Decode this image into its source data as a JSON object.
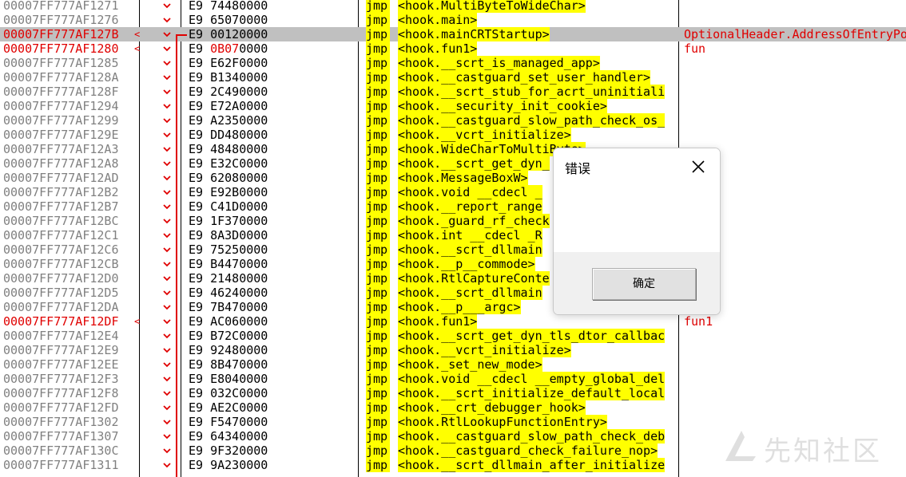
{
  "rows": [
    {
      "addr": "00007FF777AF1271",
      "bytes": "E9 74480000",
      "mnem": "jmp",
      "operand": "<hook.MultiByteToWideChar>"
    },
    {
      "addr": "00007FF777AF1276",
      "bytes": "E9 65070000",
      "mnem": "jmp",
      "operand": "<hook.main>"
    },
    {
      "addr": "00007FF777AF127B",
      "arrow": "<",
      "bytes": "E9 00120000",
      "mnem": "jmp",
      "operand": "<hook.mainCRTStartup>",
      "comment": "OptionalHeader.AddressOfEntryPoint",
      "selected": true
    },
    {
      "addr": "00007FF777AF1280",
      "arrow": "<",
      "bytes": "E9 0B070000",
      "bytes_pre": "E9 ",
      "bytes_hl": "0B07",
      "bytes_post": "0000",
      "mnem": "jmp",
      "operand": "<hook.fun1>",
      "comment": "fun"
    },
    {
      "addr": "00007FF777AF1285",
      "bytes": "E9 E62F0000",
      "mnem": "jmp",
      "operand": "<hook.__scrt_is_managed_app>"
    },
    {
      "addr": "00007FF777AF128A",
      "bytes": "E9 B1340000",
      "mnem": "jmp",
      "operand": "<hook.__castguard_set_user_handler>"
    },
    {
      "addr": "00007FF777AF128F",
      "bytes": "E9 2C490000",
      "mnem": "jmp",
      "operand": "<hook.__scrt_stub_for_acrt_uninitiali"
    },
    {
      "addr": "00007FF777AF1294",
      "bytes": "E9 E72A0000",
      "mnem": "jmp",
      "operand": "<hook.__security_init_cookie>"
    },
    {
      "addr": "00007FF777AF1299",
      "bytes": "E9 A2350000",
      "mnem": "jmp",
      "operand": "<hook.__castguard_slow_path_check_os_"
    },
    {
      "addr": "00007FF777AF129E",
      "bytes": "E9 DD480000",
      "mnem": "jmp",
      "operand": "<hook.__vcrt_initialize>"
    },
    {
      "addr": "00007FF777AF12A3",
      "bytes": "E9 48480000",
      "mnem": "jmp",
      "operand": "<hook.WideCharToMultiByte>"
    },
    {
      "addr": "00007FF777AF12A8",
      "bytes": "E9 E32C0000",
      "mnem": "jmp",
      "operand": "<hook.__scrt_get_dyn_"
    },
    {
      "addr": "00007FF777AF12AD",
      "bytes": "E9 62080000",
      "mnem": "jmp",
      "operand": "<hook.MessageBoxW>"
    },
    {
      "addr": "00007FF777AF12B2",
      "bytes": "E9 E92B0000",
      "mnem": "jmp",
      "operand": "<hook.void __cdecl _"
    },
    {
      "addr": "00007FF777AF12B7",
      "bytes": "E9 C41D0000",
      "mnem": "jmp",
      "operand": "<hook.__report_range"
    },
    {
      "addr": "00007FF777AF12BC",
      "bytes": "E9 1F370000",
      "mnem": "jmp",
      "operand": "<hook._guard_rf_check"
    },
    {
      "addr": "00007FF777AF12C1",
      "bytes": "E9 8A3D0000",
      "mnem": "jmp",
      "operand": "<hook.int __cdecl _R"
    },
    {
      "addr": "00007FF777AF12C6",
      "bytes": "E9 75250000",
      "mnem": "jmp",
      "operand": "<hook.__scrt_dllmain"
    },
    {
      "addr": "00007FF777AF12CB",
      "bytes": "E9 B4470000",
      "mnem": "jmp",
      "operand": "<hook.__p__commode>"
    },
    {
      "addr": "00007FF777AF12D0",
      "bytes": "E9 21480000",
      "mnem": "jmp",
      "operand": "<hook.RtlCaptureConte"
    },
    {
      "addr": "00007FF777AF12D5",
      "bytes": "E9 46240000",
      "mnem": "jmp",
      "operand": "<hook.__scrt_dllmain"
    },
    {
      "addr": "00007FF777AF12DA",
      "bytes": "E9 7B470000",
      "mnem": "jmp",
      "operand": "<hook.__p___argc>"
    },
    {
      "addr": "00007FF777AF12DF",
      "arrow": "<",
      "bytes": "E9 AC060000",
      "mnem": "jmp",
      "operand": "<hook.fun1>",
      "comment": "fun1"
    },
    {
      "addr": "00007FF777AF12E4",
      "bytes": "E9 B72C0000",
      "mnem": "jmp",
      "operand": "<hook.__scrt_get_dyn_tls_dtor_callbac"
    },
    {
      "addr": "00007FF777AF12E9",
      "bytes": "E9 92480000",
      "mnem": "jmp",
      "operand": "<hook.__vcrt_initialize>"
    },
    {
      "addr": "00007FF777AF12EE",
      "bytes": "E9 8B470000",
      "mnem": "jmp",
      "operand": "<hook._set_new_mode>"
    },
    {
      "addr": "00007FF777AF12F3",
      "bytes": "E9 E8040000",
      "mnem": "jmp",
      "operand": "<hook.void __cdecl __empty_global_del"
    },
    {
      "addr": "00007FF777AF12F8",
      "bytes": "E9 032C0000",
      "mnem": "jmp",
      "operand": "<hook.__scrt_initialize_default_local"
    },
    {
      "addr": "00007FF777AF12FD",
      "bytes": "E9 AE2C0000",
      "mnem": "jmp",
      "operand": "<hook.__crt_debugger_hook>"
    },
    {
      "addr": "00007FF777AF1302",
      "bytes": "E9 F5470000",
      "mnem": "jmp",
      "operand": "<hook.RtlLookupFunctionEntry>"
    },
    {
      "addr": "00007FF777AF1307",
      "bytes": "E9 64340000",
      "mnem": "jmp",
      "operand": "<hook.__castguard_slow_path_check_deb"
    },
    {
      "addr": "00007FF777AF130C",
      "bytes": "E9 9F320000",
      "mnem": "jmp",
      "operand": "<hook.__castguard_check_failure_nop>"
    },
    {
      "addr": "00007FF777AF1311",
      "bytes": "E9 9A230000",
      "mnem": "jmp",
      "operand": "<hook.__scrt_dllmain_after_initialize"
    }
  ],
  "dialog": {
    "title": "错误",
    "message": "",
    "ok_label": "确定"
  },
  "watermark": {
    "text": "先知社区"
  },
  "colors": {
    "highlight": "#ffff00",
    "marker": "#e00000",
    "selection": "#c0c0c0",
    "address": "#808080"
  }
}
